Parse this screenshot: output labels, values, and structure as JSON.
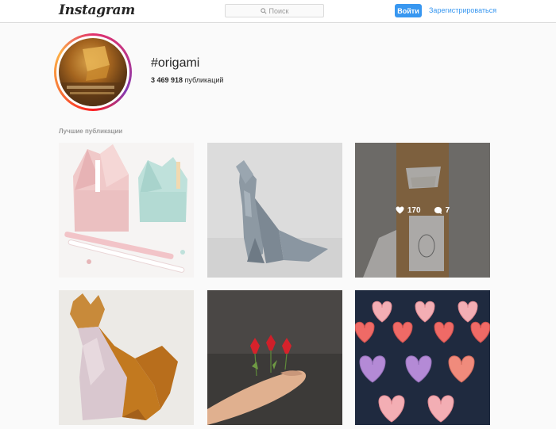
{
  "nav": {
    "logo": "Instagram",
    "search_placeholder": "Поиск",
    "login_label": "Войти",
    "signup_label": "Зарегистрироваться"
  },
  "header": {
    "hashtag": "#origami",
    "post_count": "3 469 918",
    "post_count_suffix": " публикаций"
  },
  "top_posts": {
    "title": "Лучшие публикации",
    "posts": [
      {
        "subject": "paper pen holders"
      },
      {
        "subject": "paper wolf"
      },
      {
        "subject": "kraft paper package",
        "likes": "170",
        "comments": "7"
      },
      {
        "subject": "paper cat"
      },
      {
        "subject": "paper flowers on finger"
      },
      {
        "subject": "paper hearts"
      }
    ]
  },
  "colors": {
    "accent": "#3897f0",
    "border": "#dbdbdb",
    "background": "#fafafa"
  }
}
